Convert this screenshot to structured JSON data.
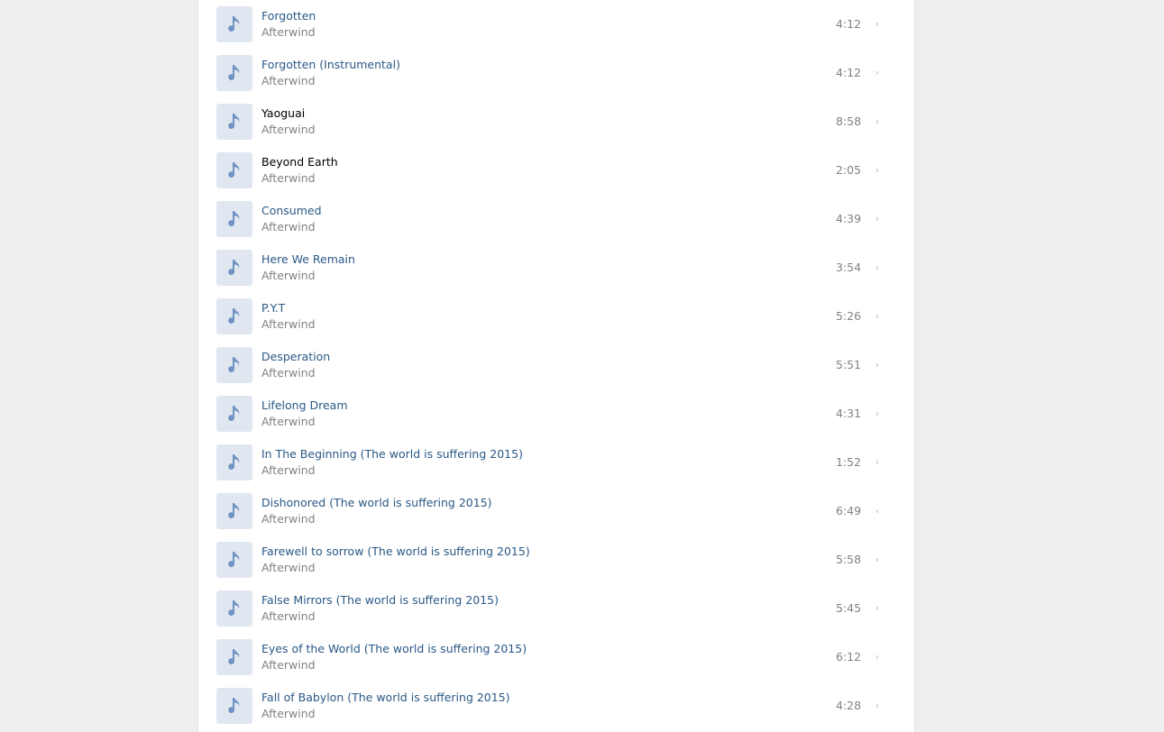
{
  "tracks": [
    {
      "title": "Forgotten",
      "artist": "Afterwind",
      "duration": "4:12",
      "title_color": "link"
    },
    {
      "title": "Forgotten (Instrumental)",
      "artist": "Afterwind",
      "duration": "4:12",
      "title_color": "link"
    },
    {
      "title": "Yaoguai",
      "artist": "Afterwind",
      "duration": "8:58",
      "title_color": "dark"
    },
    {
      "title": "Beyond Earth",
      "artist": "Afterwind",
      "duration": "2:05",
      "title_color": "dark"
    },
    {
      "title": "Consumed",
      "artist": "Afterwind",
      "duration": "4:39",
      "title_color": "link"
    },
    {
      "title": "Here We Remain",
      "artist": "Afterwind",
      "duration": "3:54",
      "title_color": "link"
    },
    {
      "title": "P.Y.T",
      "artist": "Afterwind",
      "duration": "5:26",
      "title_color": "link"
    },
    {
      "title": "Desperation",
      "artist": "Afterwind",
      "duration": "5:51",
      "title_color": "link"
    },
    {
      "title": "Lifelong Dream",
      "artist": "Afterwind",
      "duration": "4:31",
      "title_color": "link"
    },
    {
      "title": "In The Beginning (The world is suffering 2015)",
      "artist": "Afterwind",
      "duration": "1:52",
      "title_color": "link"
    },
    {
      "title": "Dishonored (The world is suffering 2015)",
      "artist": "Afterwind",
      "duration": "6:49",
      "title_color": "link"
    },
    {
      "title": "Farewell to sorrow (The world is suffering 2015)",
      "artist": "Afterwind",
      "duration": "5:58",
      "title_color": "link"
    },
    {
      "title": "False Mirrors (The world is suffering 2015)",
      "artist": "Afterwind",
      "duration": "5:45",
      "title_color": "link"
    },
    {
      "title": "Eyes of the World (The world is suffering 2015)",
      "artist": "Afterwind",
      "duration": "6:12",
      "title_color": "link"
    },
    {
      "title": "Fall of Babylon (The world is suffering 2015)",
      "artist": "Afterwind",
      "duration": "4:28",
      "title_color": "link"
    }
  ],
  "icons": {
    "cover": "music-note-icon"
  },
  "colors": {
    "page_background": "#edeef0",
    "panel_background": "#ffffff",
    "title_link": "#2a5885",
    "title_dark": "#000000",
    "secondary_text": "#828282",
    "cover_background": "#e1e7f0",
    "note_icon": "#6f93c2"
  }
}
